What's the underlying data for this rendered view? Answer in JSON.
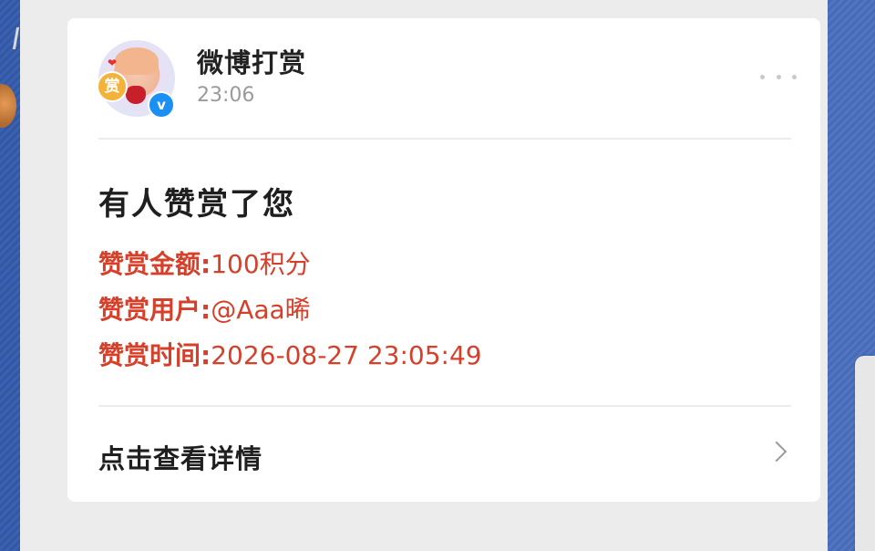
{
  "message": {
    "sender_name": "微博打赏",
    "timestamp": "23:06",
    "avatar_badge_text": "赏",
    "verified_mark": "v",
    "title": "有人赞赏了您",
    "amount_label": "赞赏金额:",
    "amount_value": "100积分",
    "user_label": "赞赏用户:",
    "user_value": "@Aaa晞",
    "time_label": "赞赏时间:",
    "time_value": "2026-08-27 23:05:49",
    "detail_link": "点击查看详情"
  },
  "colors": {
    "accent_red": "#d6402a",
    "verified_blue": "#1b8ff2",
    "panel_gray": "#ececec"
  },
  "icons": [
    "more-dots-icon",
    "verified-icon",
    "chevron-right-icon"
  ]
}
